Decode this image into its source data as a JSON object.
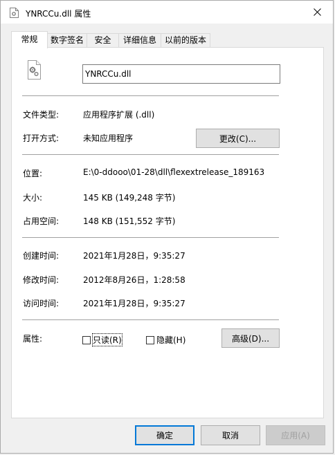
{
  "window": {
    "title": "YNRCCu.dll 属性"
  },
  "tabs": [
    {
      "label": "常规"
    },
    {
      "label": "数字签名"
    },
    {
      "label": "安全"
    },
    {
      "label": "详细信息"
    },
    {
      "label": "以前的版本"
    }
  ],
  "general": {
    "file_name": "YNRCCu.dll",
    "file_type_label": "文件类型:",
    "file_type_value": "应用程序扩展 (.dll)",
    "open_with_label": "打开方式:",
    "open_with_value": "未知应用程序",
    "change_button": "更改(C)...",
    "location_label": "位置:",
    "location_value": "E:\\0-ddooo\\01-28\\dll\\flexextrelease_189163",
    "size_label": "大小:",
    "size_value": "145 KB (149,248 字节)",
    "size_on_disk_label": "占用空间:",
    "size_on_disk_value": "148 KB (151,552 字节)",
    "created_label": "创建时间:",
    "created_value": "2021年1月28日，9:35:27",
    "modified_label": "修改时间:",
    "modified_value": "2012年8月26日，1:28:58",
    "accessed_label": "访问时间:",
    "accessed_value": "2021年1月28日，9:35:27",
    "attributes_label": "属性:",
    "readonly_label": "只读(R)",
    "readonly_checked": false,
    "hidden_label": "隐藏(H)",
    "hidden_checked": false,
    "advanced_button": "高级(D)..."
  },
  "footer": {
    "ok_button": "确定",
    "cancel_button": "取消",
    "apply_button": "应用(A)"
  },
  "icons": {
    "title": "dll-file-icon",
    "close": "close-icon",
    "file": "dll-gear-file-icon"
  }
}
